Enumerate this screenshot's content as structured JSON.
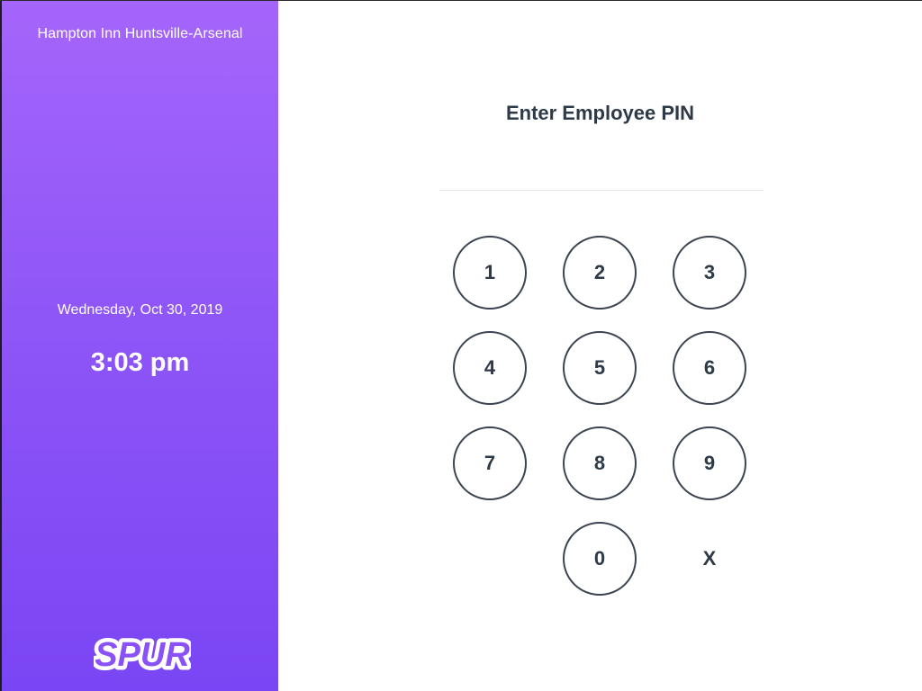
{
  "sidebar": {
    "location": "Hampton Inn Huntsville-Arsenal",
    "date": "Wednesday, Oct 30, 2019",
    "time": "3:03 pm",
    "logo_text": "SPUR",
    "gradient_top": "#a565fb",
    "gradient_bottom": "#7a45f4"
  },
  "main": {
    "title": "Enter Employee PIN",
    "pin_value": "",
    "keypad": {
      "keys": [
        "1",
        "2",
        "3",
        "4",
        "5",
        "6",
        "7",
        "8",
        "9",
        "0",
        "X"
      ]
    }
  },
  "colors": {
    "text_dark": "#2e3a48",
    "key_border": "#3b4450",
    "divider": "#e8e8ea"
  }
}
